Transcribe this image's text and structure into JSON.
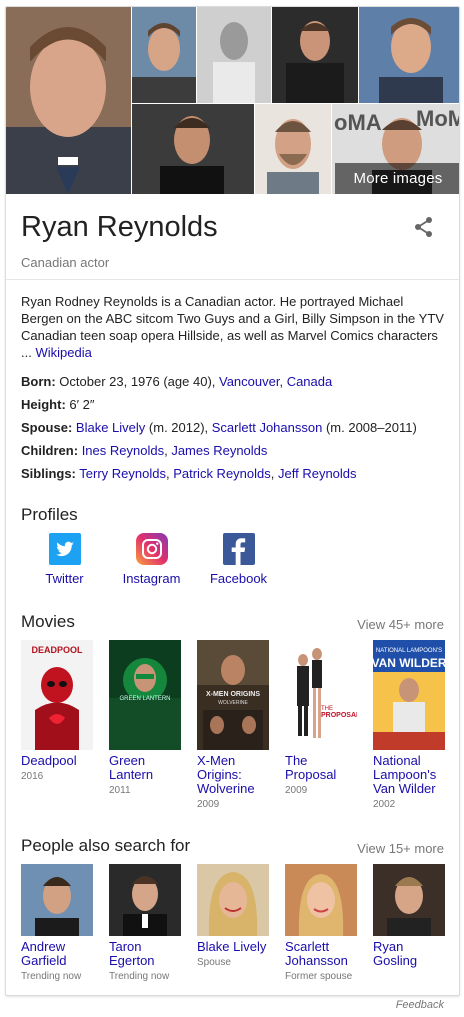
{
  "collage": {
    "more_images_label": "More images"
  },
  "entity": {
    "name": "Ryan Reynolds",
    "subtitle": "Canadian actor"
  },
  "description": {
    "text": "Ryan Rodney Reynolds is a Canadian actor. He portrayed Michael Bergen on the ABC sitcom Two Guys and a Girl, Billy Simpson in the YTV Canadian teen soap opera Hillside, as well as Marvel Comics characters ... ",
    "source": "Wikipedia"
  },
  "facts": {
    "born": {
      "label": "Born:",
      "value": " October 23, 1976 (age 40), ",
      "link": "Vancouver, Canada"
    },
    "height": {
      "label": "Height:",
      "value": " 6′ 2″"
    },
    "spouse": {
      "label": "Spouse:",
      "link1": "Blake Lively",
      "note1": " (m. 2012), ",
      "link2": "Scarlett Johansson",
      "note2": " (m. 2008–2011)"
    },
    "children": {
      "label": "Children:",
      "link1": "Ines Reynolds",
      "sep": ", ",
      "link2": "James Reynolds"
    },
    "siblings": {
      "label": "Siblings:",
      "link1": "Terry Reynolds",
      "sep1": ", ",
      "link2": "Patrick Reynolds",
      "sep2": ", ",
      "link3": "Jeff Reynolds"
    }
  },
  "profiles": {
    "title": "Profiles",
    "items": [
      {
        "label": "Twitter",
        "icon": "twitter-icon",
        "color": "#1da1f2"
      },
      {
        "label": "Instagram",
        "icon": "instagram-icon",
        "color": "#c13584"
      },
      {
        "label": "Facebook",
        "icon": "facebook-icon",
        "color": "#3b5998"
      }
    ]
  },
  "movies": {
    "title": "Movies",
    "view_more": "View 45+ more",
    "items": [
      {
        "name": "Deadpool",
        "year": "2016"
      },
      {
        "name": "Green Lantern",
        "year": "2011"
      },
      {
        "name": "X-Men Origins: Wolverine",
        "year": "2009"
      },
      {
        "name": "The Proposal",
        "year": "2009"
      },
      {
        "name": "National Lampoon's Van Wilder",
        "year": "2002"
      }
    ]
  },
  "people": {
    "title": "People also search for",
    "view_more": "View 15+ more",
    "items": [
      {
        "name": "Andrew Garfield",
        "note": "Trending now"
      },
      {
        "name": "Taron Egerton",
        "note": "Trending now"
      },
      {
        "name": "Blake Lively",
        "note": "Spouse"
      },
      {
        "name": "Scarlett Johansson",
        "note": "Former spouse"
      },
      {
        "name": "Ryan Gosling",
        "note": ""
      }
    ]
  },
  "footer": {
    "feedback": "Feedback"
  },
  "colors": {
    "link": "#1a0dab",
    "muted": "#777777"
  }
}
